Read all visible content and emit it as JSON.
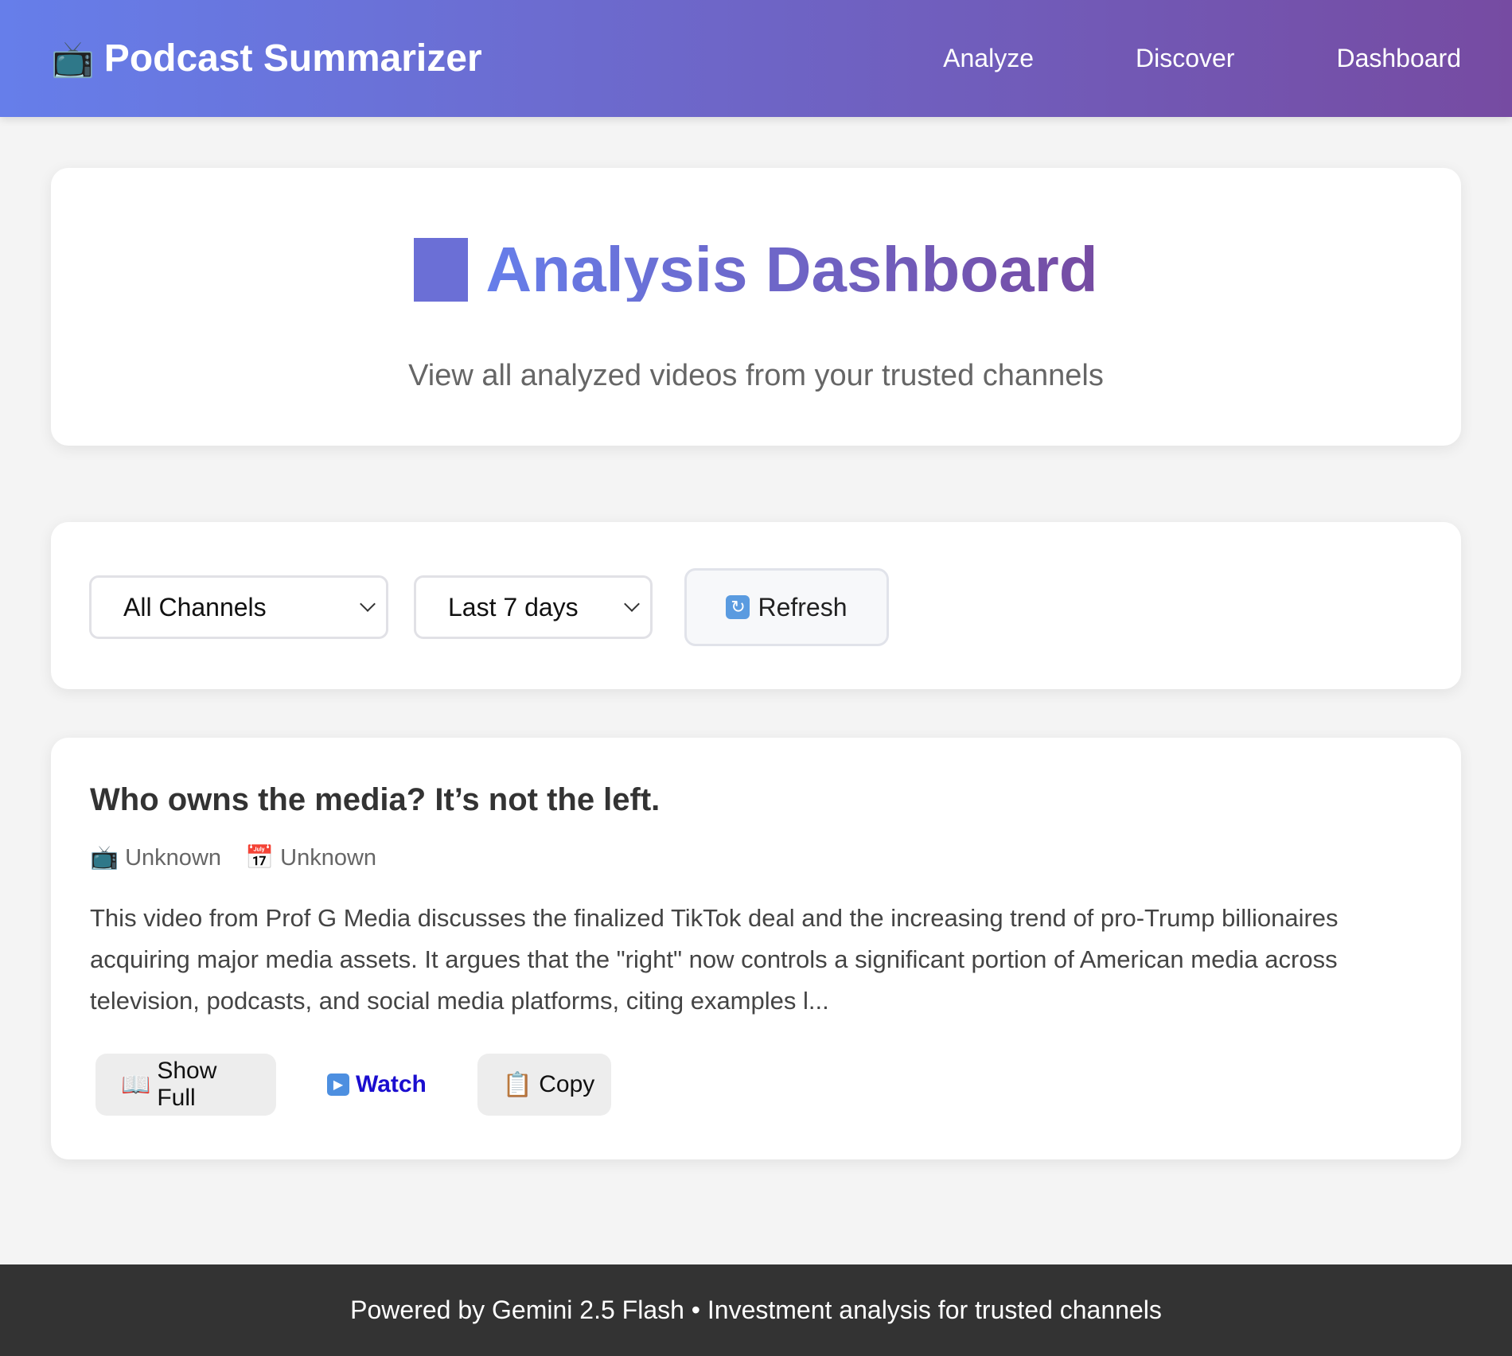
{
  "header": {
    "app_icon": "tv-icon",
    "app_title": "Podcast Summarizer",
    "nav": [
      "Analyze",
      "Discover",
      "Dashboard"
    ]
  },
  "hero": {
    "title_icon": "chart-icon",
    "title": "Analysis Dashboard",
    "subtitle": "View all analyzed videos from your trusted channels"
  },
  "filters": {
    "channel_select": "All Channels",
    "period_select": "Last 7 days",
    "refresh_label": "Refresh"
  },
  "videos": [
    {
      "title": "Who owns the media? It’s not the left.",
      "channel": "Unknown",
      "date": "Unknown",
      "summary": "This video from Prof G Media discusses the finalized TikTok deal and the increasing trend of pro-Trump billionaires acquiring major media assets. It argues that the \"right\" now controls a significant portion of American media across television, podcasts, and social media platforms, citing examples l...",
      "actions": {
        "show_full": "Show Full",
        "watch": "Watch",
        "copy": "Copy"
      }
    }
  ],
  "footer": {
    "text": "Powered by Gemini 2.5 Flash • Investment analysis for trusted channels"
  },
  "colors": {
    "header_gradient_start": "#667eea",
    "header_gradient_end": "#764ba2",
    "footer_bg": "#333333",
    "link_blue": "#1a0dcf"
  }
}
